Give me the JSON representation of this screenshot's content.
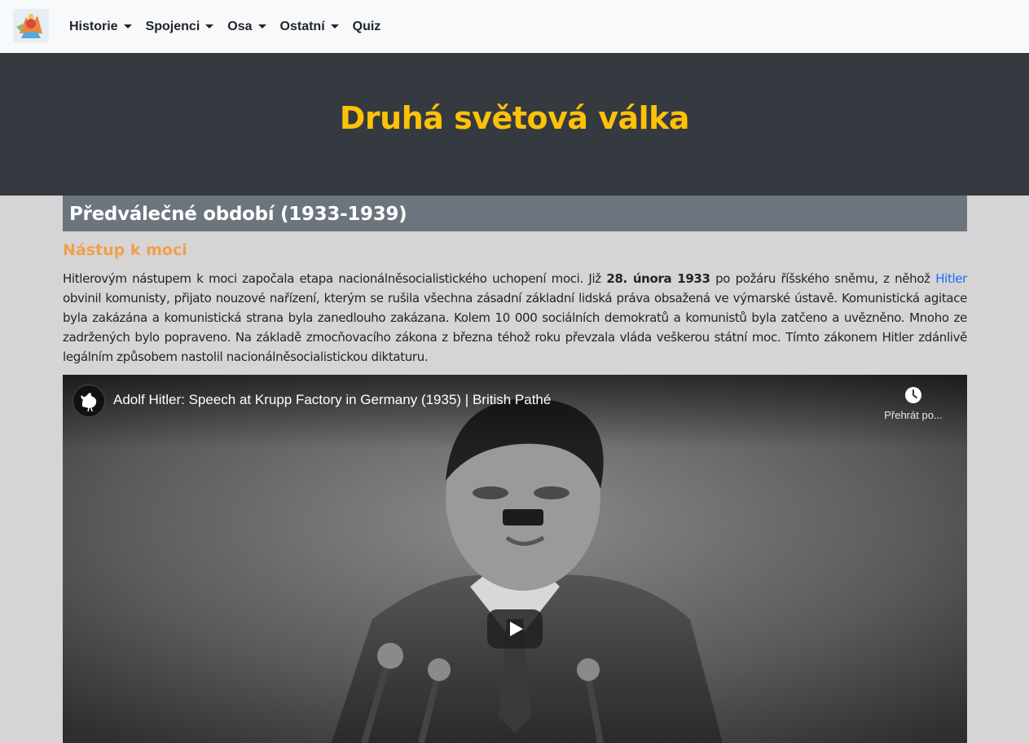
{
  "navbar": {
    "items": [
      {
        "label": "Historie",
        "dropdown": true
      },
      {
        "label": "Spojenci",
        "dropdown": true
      },
      {
        "label": "Osa",
        "dropdown": true
      },
      {
        "label": "Ostatní",
        "dropdown": true
      },
      {
        "label": "Quiz",
        "dropdown": false
      }
    ]
  },
  "hero": {
    "title": "Druhá světová válka"
  },
  "section": {
    "heading": "Předválečné období (1933-1939)",
    "subheading": "Nástup k moci",
    "paragraph": {
      "part1": "Hitlerovým nástupem k moci započala etapa nacionálněsocialistického uchopení moci. Již ",
      "bold_date": "28. února 1933",
      "part2": " po požáru říšského sněmu, z něhož ",
      "link": "Hitler",
      "part3": " obvinil komunisty, přijato nouzové nařízení, kterým se rušila všechna zásadní základní lidská práva obsažená ve výmarské ústavě. Komunistická agitace byla zakázána a komunistická strana byla zanedlouho zakázana. Kolem 10 000 sociálních demokratů a komunistů byla zatčeno a uvězněno. Mnoho ze zadržených bylo popraveno. Na základě zmocňovacího zákona z března téhož roku převzala vláda veškerou státní moc. Tímto zákonem Hitler zdánlivě legálním způsobem nastolil nacionálněsocialistickou diktaturu."
    }
  },
  "video": {
    "title": "Adolf Hitler: Speech at Krupp Factory in Germany (1935) | British Pathé",
    "watch_later_label": "Přehrát po..."
  },
  "colors": {
    "navbar_bg": "#f8f9fa",
    "hero_bg": "#343a40",
    "hero_title": "#ffc107",
    "section_head_bg": "#6c757d",
    "subheading": "#f0a04b",
    "link": "#0d6efd",
    "page_bg": "#d7d4d5"
  }
}
